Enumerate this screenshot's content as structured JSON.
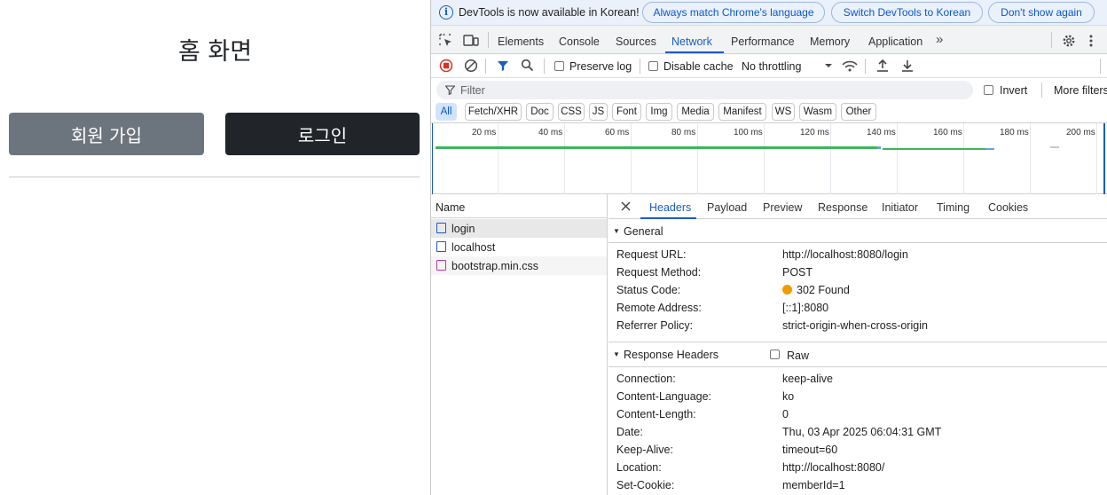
{
  "page": {
    "title": "홈 화면",
    "signup_label": "회원 가입",
    "login_label": "로그인",
    "colors": {
      "signup_bg": "#6c757d",
      "login_bg": "#212529"
    }
  },
  "devtools": {
    "infobar": {
      "text": "DevTools is now available in Korean!",
      "btn_match": "Always match Chrome's language",
      "btn_switch": "Switch DevTools to Korean",
      "btn_dismiss": "Don't show again"
    },
    "tabs": [
      "Elements",
      "Console",
      "Sources",
      "Network",
      "Performance",
      "Memory",
      "Application"
    ],
    "active_tab": "Network",
    "toolbar": {
      "preserve_log": "Preserve log",
      "disable_cache": "Disable cache",
      "throttling": "No throttling"
    },
    "filter": {
      "placeholder": "Filter",
      "invert": "Invert",
      "more_filters": "More filters"
    },
    "types": [
      "All",
      "Fetch/XHR",
      "Doc",
      "CSS",
      "JS",
      "Font",
      "Img",
      "Media",
      "Manifest",
      "WS",
      "Wasm",
      "Other"
    ],
    "timeline": {
      "ticks": [
        "20 ms",
        "40 ms",
        "60 ms",
        "80 ms",
        "100 ms",
        "120 ms",
        "140 ms",
        "160 ms",
        "180 ms",
        "200 ms"
      ]
    },
    "requests": {
      "header": "Name",
      "items": [
        {
          "name": "login",
          "type": "doc"
        },
        {
          "name": "localhost",
          "type": "doc"
        },
        {
          "name": "bootstrap.min.css",
          "type": "css"
        }
      ]
    },
    "details": {
      "tabs": [
        "Headers",
        "Payload",
        "Preview",
        "Response",
        "Initiator",
        "Timing",
        "Cookies"
      ],
      "active": "Headers",
      "general": {
        "title": "General",
        "rows": [
          {
            "key": "Request URL:",
            "value": "http://localhost:8080/login"
          },
          {
            "key": "Request Method:",
            "value": "POST"
          },
          {
            "key": "Status Code:",
            "value": "302 Found"
          },
          {
            "key": "Remote Address:",
            "value": "[::1]:8080"
          },
          {
            "key": "Referrer Policy:",
            "value": "strict-origin-when-cross-origin"
          }
        ],
        "status_color": "#f29900"
      },
      "response_headers": {
        "title": "Response Headers",
        "raw": "Raw",
        "rows": [
          {
            "key": "Connection:",
            "value": "keep-alive"
          },
          {
            "key": "Content-Language:",
            "value": "ko"
          },
          {
            "key": "Content-Length:",
            "value": "0"
          },
          {
            "key": "Date:",
            "value": "Thu, 03 Apr 2025 06:04:31 GMT"
          },
          {
            "key": "Keep-Alive:",
            "value": "timeout=60"
          },
          {
            "key": "Location:",
            "value": "http://localhost:8080/"
          },
          {
            "key": "Set-Cookie:",
            "value": "memberId=1"
          }
        ]
      }
    }
  }
}
